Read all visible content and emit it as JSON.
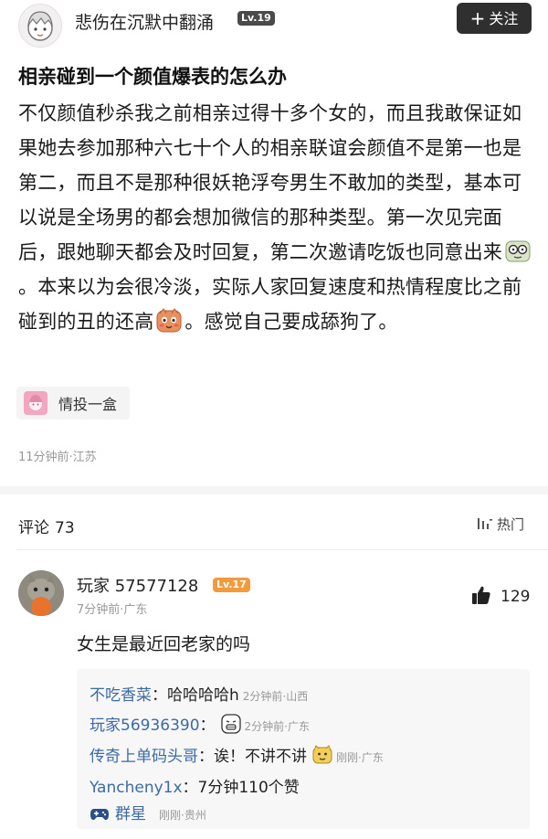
{
  "header": {
    "author": "悲伤在沉默中翻涌",
    "level": "Lv.19",
    "follow_label": "关注"
  },
  "post": {
    "title": "相亲碰到一个颜值爆表的怎么办",
    "body_part1": "不仅颜值秒杀我之前相亲过得十多个女的，而且我敢保证如果她去参加那种六七十个人的相亲联谊会颜值不是第一也是第二，而且不是那种很妖艳浮夸男生不敢加的类型，基本可以说是全场男的都会想加微信的那种类型。第一次见完面后，跟她聊天都会及时回复，第二次邀请吃饭也同意出来",
    "body_part2": "。本来以为会很冷淡，实际人家回复速度和热情程度比之前碰到的丑的还高",
    "body_part3": "。感觉自己要成舔狗了。",
    "tag": "情投一盒",
    "meta": "11分钟前·江苏"
  },
  "comments": {
    "label": "评论",
    "count": "73",
    "sort_label": "热门"
  },
  "comment": {
    "user": "玩家 57577128",
    "level": "Lv.17",
    "meta": "7分钟前·广东",
    "likes": "129",
    "text": "女生是最近回老家的吗"
  },
  "replies": [
    {
      "name": "不吃香菜",
      "text": "哈哈哈哈h",
      "meta": "2分钟前·山西"
    },
    {
      "name": "玩家56936390",
      "text": "",
      "meta": "2分钟前·广东"
    },
    {
      "name": "传奇上单码头哥",
      "text": "诶！不讲不讲",
      "meta": "刚刚·广东"
    },
    {
      "name": "Yancheny1x",
      "text": "7分钟110个赞",
      "meta": ""
    },
    {
      "name": "群星",
      "text": "",
      "meta": "刚刚·贵州"
    }
  ]
}
